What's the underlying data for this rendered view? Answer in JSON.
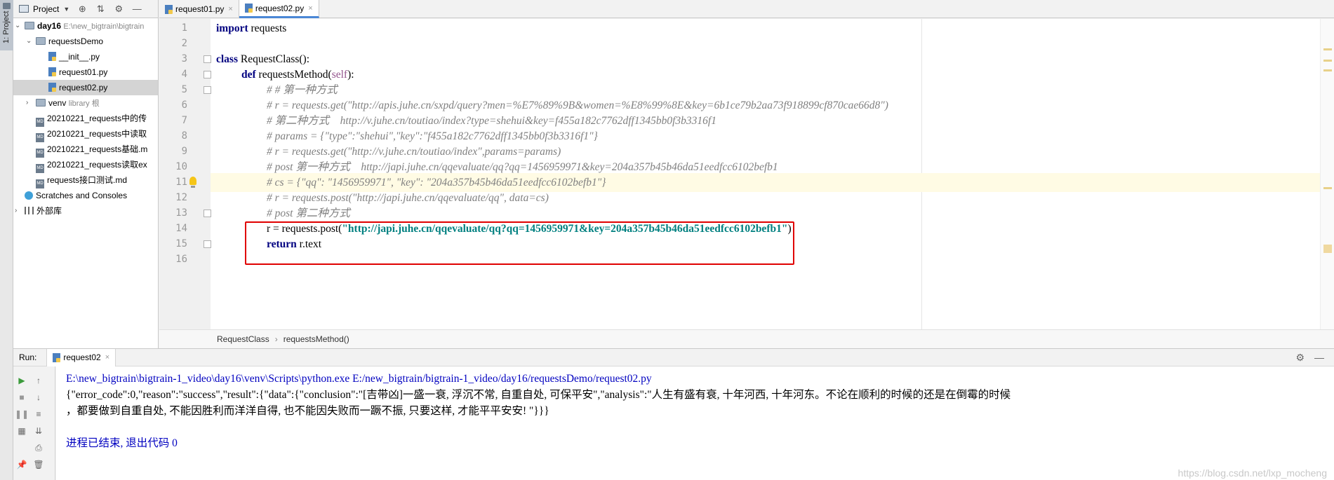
{
  "stripe": {
    "label": "1: Project"
  },
  "project": {
    "title": "Project",
    "tree": [
      {
        "label": "day16",
        "extra": "E:\\new_bigtrain\\bigtrain"
      },
      {
        "label": "requestsDemo"
      },
      {
        "label": "__init__.py"
      },
      {
        "label": "request01.py"
      },
      {
        "label": "request02.py"
      },
      {
        "label": "venv",
        "extra": "library 根"
      },
      {
        "label": "20210221_requests中的传"
      },
      {
        "label": "20210221_requests中读取"
      },
      {
        "label": "20210221_requests基础.m"
      },
      {
        "label": "20210221_requests读取ex"
      },
      {
        "label": "requests接口测试.md"
      },
      {
        "label": "Scratches and Consoles"
      },
      {
        "label": "外部库"
      }
    ]
  },
  "tabs": [
    {
      "label": "request01.py"
    },
    {
      "label": "request02.py"
    }
  ],
  "code": {
    "line_numbers": [
      "1",
      "2",
      "3",
      "4",
      "5",
      "6",
      "7",
      "8",
      "9",
      "10",
      "11",
      "12",
      "13",
      "14",
      "15",
      "16"
    ],
    "l1": {
      "kw": "import",
      "rest": " requests"
    },
    "l3": {
      "kw": "class",
      "rest": " RequestClass():"
    },
    "l4": {
      "kw": "def",
      "name": " requestsMethod(",
      "self": "self",
      "end": "):"
    },
    "l5": "# # 第一种方式",
    "l6": "# r = requests.get(\"http://apis.juhe.cn/sxpd/query?men=%E7%89%9B&women=%E8%99%8E&key=6b1ce79b2aa73f918899cf870cae66d8\")",
    "l7": "# 第二种方式    http://v.juhe.cn/toutiao/index?type=shehui&key=f455a182c7762dff1345bb0f3b3316f1",
    "l8": "# params = {\"type\":\"shehui\",\"key\":\"f455a182c7762dff1345bb0f3b3316f1\"}",
    "l9": "# r = requests.get(\"http://v.juhe.cn/toutiao/index\",params=params)",
    "l10": "# post 第一种方式    http://japi.juhe.cn/qqevaluate/qq?qq=1456959971&key=204a357b45b46da51eedfcc6102befb1",
    "l11": "# cs = {\"qq\": \"1456959971\", \"key\": \"204a357b45b46da51eedfcc6102befb1\"}",
    "l12": "# r = requests.post(\"http://japi.juhe.cn/qqevaluate/qq\", data=cs)",
    "l13": "# post 第二种方式",
    "l14": {
      "pre": "r = requests.post(",
      "str": "\"http://japi.juhe.cn/qqevaluate/qq?qq=1456959971&key=204a357b45b46da51eedfcc6102befb1\"",
      "post": ")"
    },
    "l15": {
      "kw": "return",
      "rest": " r.text"
    }
  },
  "breadcrumb": {
    "class": "RequestClass",
    "method": "requestsMethod()"
  },
  "run": {
    "label": "Run:",
    "tab": "request02",
    "cmd": "E:\\new_bigtrain\\bigtrain-1_video\\day16\\venv\\Scripts\\python.exe E:/new_bigtrain/bigtrain-1_video/day16/requestsDemo/request02.py",
    "out1": "{\"error_code\":0,\"reason\":\"success\",\"result\":{\"data\":{\"conclusion\":\"[吉带凶]一盛一衰, 浮沉不常, 自重自处, 可保平安\",\"analysis\":\"人生有盛有衰, 十年河西, 十年河东。不论在顺利的时候的还是在倒霉的时候",
    "out2": "，都要做到自重自处, 不能因胜利而洋洋自得, 也不能因失败而一蹶不振, 只要这样, 才能平平安安! \"}}}",
    "exit": "进程已结束, 退出代码 0"
  },
  "watermark": "https://blog.csdn.net/lxp_mocheng"
}
